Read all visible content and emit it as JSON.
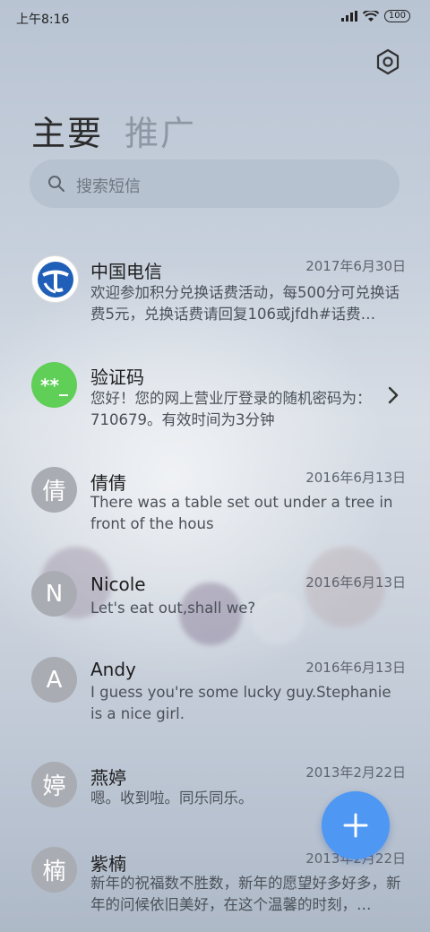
{
  "status_bar": {
    "time": "上午8:16",
    "battery": "100"
  },
  "tabs": [
    {
      "label": "主要",
      "active": true
    },
    {
      "label": "推广",
      "active": false
    }
  ],
  "search": {
    "placeholder": "搜索短信"
  },
  "conversations": [
    {
      "name": "中国电信",
      "date": "2017年6月30日",
      "preview": "欢迎参加积分兑换话费活动，每500分可兑换话费5元，兑换话费请回复106或jfdh#话费…",
      "avatar": "telecom-logo"
    },
    {
      "name": "验证码",
      "date": "",
      "preview": "您好！您的网上营业厅登录的随机密码为：710679。有效时间为3分钟",
      "avatar_text": "**_"
    },
    {
      "name": "倩倩",
      "date": "2016年6月13日",
      "preview": "There was a table set out under a tree in front of the hous",
      "avatar_text": "倩"
    },
    {
      "name": "Nicole",
      "date": "2016年6月13日",
      "preview": "Let's eat out,shall we?",
      "avatar_text": "N"
    },
    {
      "name": "Andy",
      "date": "2016年6月13日",
      "preview": "I guess you're some lucky guy.Stephanie is a nice girl.",
      "avatar_text": "A"
    },
    {
      "name": "燕婷",
      "date": "2013年2月22日",
      "preview": "嗯。收到啦。同乐同乐。",
      "avatar_text": "婷"
    },
    {
      "name": "紫楠",
      "date": "2013年2月22日",
      "preview": "新年的祝福数不胜数，新年的愿望好多好多，新年的问候依旧美好，在这个温馨的时刻，…",
      "avatar_text": "楠"
    }
  ],
  "colors": {
    "accent": "#4e97f3",
    "verification_avatar": "#5fcf57",
    "avatar_gray": "#a9acb2"
  }
}
